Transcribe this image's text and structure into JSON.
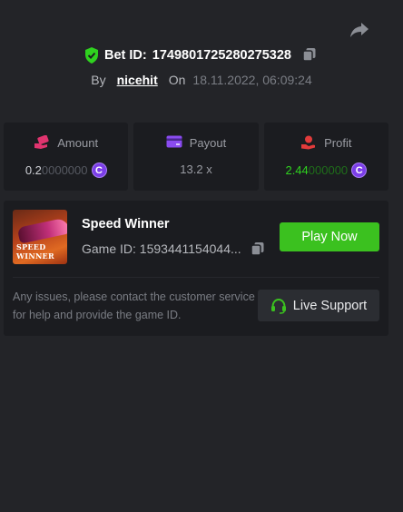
{
  "header": {
    "bet_label": "Bet ID:",
    "bet_id": "174980172528027532​8",
    "by_label": "By",
    "username": "nicehit",
    "on_label": "On",
    "date": "18.11.2022, 06:09:24"
  },
  "stats": {
    "amount": {
      "label": "Amount",
      "value_bright": "0.2",
      "value_dim": "0000000"
    },
    "payout": {
      "label": "Payout",
      "value": "13.2 x"
    },
    "profit": {
      "label": "Profit",
      "value_bright": "2.44",
      "value_dim": "000000"
    }
  },
  "game": {
    "name": "Speed Winner",
    "id_label": "Game ID:",
    "id_value": "1593441154044...",
    "thumb_line1": "SPEED",
    "thumb_line2": "WINNER",
    "play_label": "Play Now",
    "issue_text": "Any issues, please contact the customer service for help and provide the game ID.",
    "support_label": "Live Support"
  },
  "colors": {
    "background": "#232428",
    "card": "#1b1c20",
    "play_green": "#3bc11f",
    "profit_green": "#2fd21f",
    "coin_purple": "#7b3ee8"
  },
  "icons": [
    "share-icon",
    "shield-check-icon",
    "copy-icon",
    "wallet-hand-icon",
    "card-icon",
    "profit-hand-icon",
    "coin-icon",
    "headset-icon"
  ]
}
